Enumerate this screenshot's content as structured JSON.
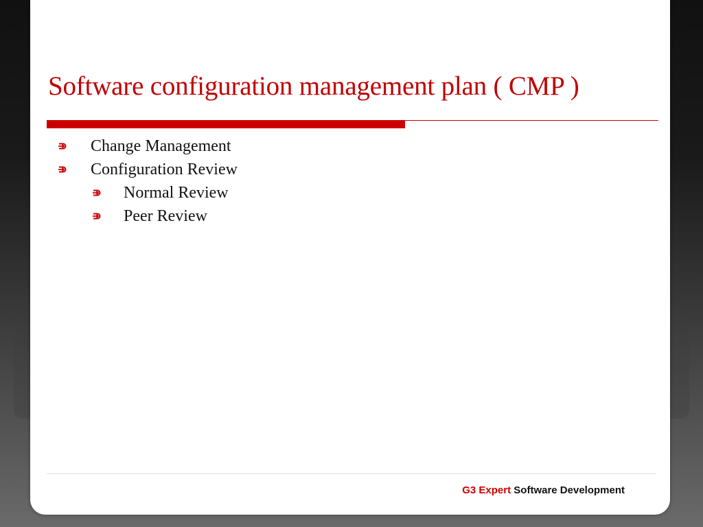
{
  "slide": {
    "title": "Software configuration management plan ( CMP )",
    "bullet_icon": "circled-arrow-right-icon",
    "accent_color": "#cc0000",
    "bullets": [
      {
        "level": 1,
        "text": "Change Management"
      },
      {
        "level": 1,
        "text": "Configuration Review"
      },
      {
        "level": 2,
        "text": "Normal Review"
      },
      {
        "level": 2,
        "text": "Peer Review"
      }
    ],
    "footer": {
      "brand": "G3 Expert",
      "text": "Software Development"
    }
  }
}
